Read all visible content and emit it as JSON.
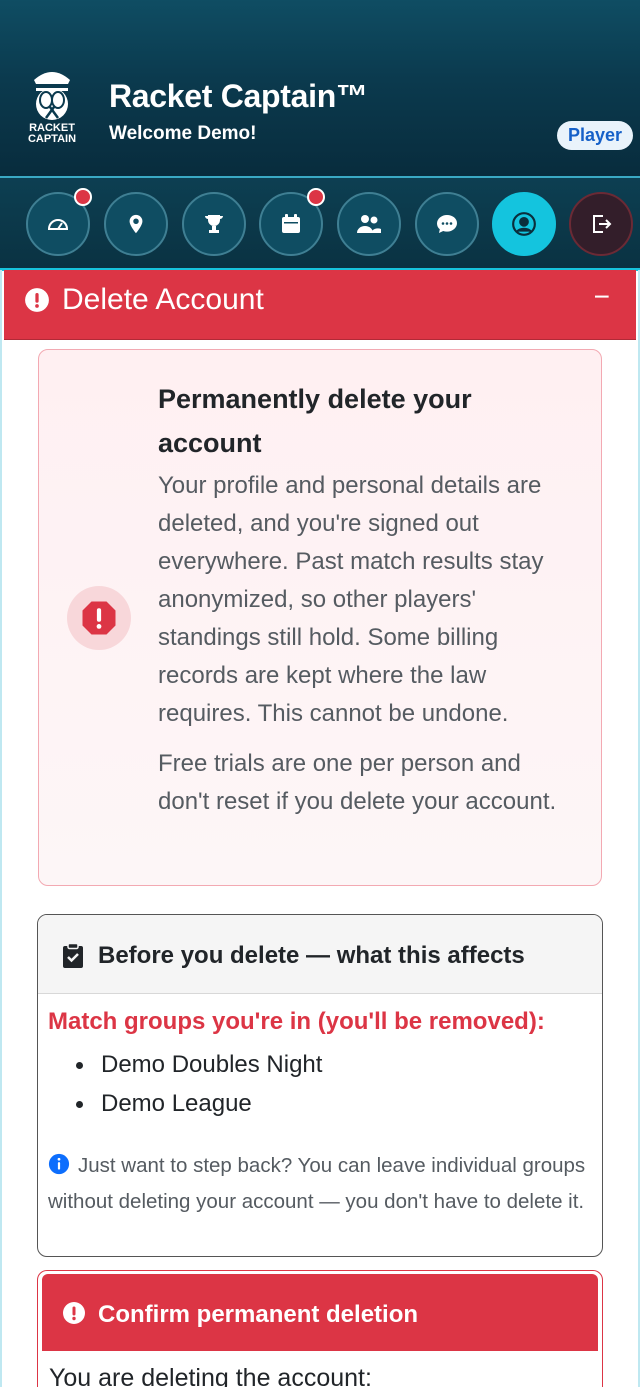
{
  "header": {
    "logo_text_line1": "RACKET",
    "logo_text_line2": "CAPTAIN",
    "app_title": "Racket Captain™",
    "welcome": "Welcome Demo!",
    "role_badge": "Player"
  },
  "nav": {
    "items": [
      {
        "icon": "dashboard-gauge-icon",
        "notification": true
      },
      {
        "icon": "location-pin-icon",
        "notification": false
      },
      {
        "icon": "trophy-icon",
        "notification": false
      },
      {
        "icon": "calendar-icon",
        "notification": true
      },
      {
        "icon": "users-icon",
        "notification": false
      },
      {
        "icon": "chat-icon",
        "notification": false
      },
      {
        "icon": "user-circle-icon",
        "notification": false,
        "active": true
      },
      {
        "icon": "logout-icon",
        "notification": false
      }
    ]
  },
  "section": {
    "title": "Delete Account",
    "collapse_symbol": "−"
  },
  "warning": {
    "title": "Permanently delete your account",
    "body": "Your profile and personal details are deleted, and you're signed out everywhere. Past match results stay anonymized, so other players' standings still hold. Some billing records are kept where the law requires. This cannot be undone.",
    "note": "Free trials are one per person and don't reset if you delete your account."
  },
  "affects": {
    "title": "Before you delete — what this affects",
    "groups_label": "Match groups you're in (you'll be removed):",
    "groups": [
      "Demo Doubles Night",
      "Demo League"
    ],
    "info": "Just want to step back? You can leave individual groups without deleting your account — you don't have to delete it."
  },
  "confirm": {
    "title": "Confirm permanent deletion",
    "body": "You are deleting the account:"
  },
  "colors": {
    "danger": "#dc3545",
    "accent": "#14c4de",
    "header_bg": "#0b3a4e",
    "badge_text": "#1560c8"
  }
}
